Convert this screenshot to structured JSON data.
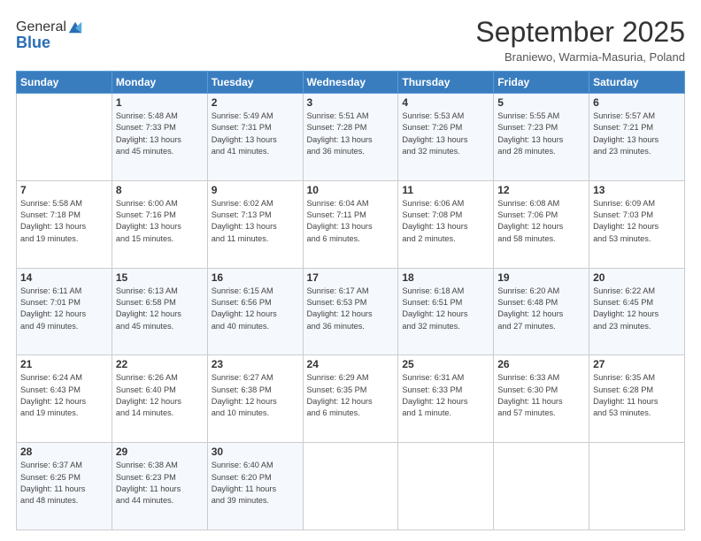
{
  "logo": {
    "line1": "General",
    "line2": "Blue"
  },
  "title": "September 2025",
  "location": "Braniewo, Warmia-Masuria, Poland",
  "weekdays": [
    "Sunday",
    "Monday",
    "Tuesday",
    "Wednesday",
    "Thursday",
    "Friday",
    "Saturday"
  ],
  "weeks": [
    [
      {
        "day": "",
        "info": ""
      },
      {
        "day": "1",
        "info": "Sunrise: 5:48 AM\nSunset: 7:33 PM\nDaylight: 13 hours\nand 45 minutes."
      },
      {
        "day": "2",
        "info": "Sunrise: 5:49 AM\nSunset: 7:31 PM\nDaylight: 13 hours\nand 41 minutes."
      },
      {
        "day": "3",
        "info": "Sunrise: 5:51 AM\nSunset: 7:28 PM\nDaylight: 13 hours\nand 36 minutes."
      },
      {
        "day": "4",
        "info": "Sunrise: 5:53 AM\nSunset: 7:26 PM\nDaylight: 13 hours\nand 32 minutes."
      },
      {
        "day": "5",
        "info": "Sunrise: 5:55 AM\nSunset: 7:23 PM\nDaylight: 13 hours\nand 28 minutes."
      },
      {
        "day": "6",
        "info": "Sunrise: 5:57 AM\nSunset: 7:21 PM\nDaylight: 13 hours\nand 23 minutes."
      }
    ],
    [
      {
        "day": "7",
        "info": "Sunrise: 5:58 AM\nSunset: 7:18 PM\nDaylight: 13 hours\nand 19 minutes."
      },
      {
        "day": "8",
        "info": "Sunrise: 6:00 AM\nSunset: 7:16 PM\nDaylight: 13 hours\nand 15 minutes."
      },
      {
        "day": "9",
        "info": "Sunrise: 6:02 AM\nSunset: 7:13 PM\nDaylight: 13 hours\nand 11 minutes."
      },
      {
        "day": "10",
        "info": "Sunrise: 6:04 AM\nSunset: 7:11 PM\nDaylight: 13 hours\nand 6 minutes."
      },
      {
        "day": "11",
        "info": "Sunrise: 6:06 AM\nSunset: 7:08 PM\nDaylight: 13 hours\nand 2 minutes."
      },
      {
        "day": "12",
        "info": "Sunrise: 6:08 AM\nSunset: 7:06 PM\nDaylight: 12 hours\nand 58 minutes."
      },
      {
        "day": "13",
        "info": "Sunrise: 6:09 AM\nSunset: 7:03 PM\nDaylight: 12 hours\nand 53 minutes."
      }
    ],
    [
      {
        "day": "14",
        "info": "Sunrise: 6:11 AM\nSunset: 7:01 PM\nDaylight: 12 hours\nand 49 minutes."
      },
      {
        "day": "15",
        "info": "Sunrise: 6:13 AM\nSunset: 6:58 PM\nDaylight: 12 hours\nand 45 minutes."
      },
      {
        "day": "16",
        "info": "Sunrise: 6:15 AM\nSunset: 6:56 PM\nDaylight: 12 hours\nand 40 minutes."
      },
      {
        "day": "17",
        "info": "Sunrise: 6:17 AM\nSunset: 6:53 PM\nDaylight: 12 hours\nand 36 minutes."
      },
      {
        "day": "18",
        "info": "Sunrise: 6:18 AM\nSunset: 6:51 PM\nDaylight: 12 hours\nand 32 minutes."
      },
      {
        "day": "19",
        "info": "Sunrise: 6:20 AM\nSunset: 6:48 PM\nDaylight: 12 hours\nand 27 minutes."
      },
      {
        "day": "20",
        "info": "Sunrise: 6:22 AM\nSunset: 6:45 PM\nDaylight: 12 hours\nand 23 minutes."
      }
    ],
    [
      {
        "day": "21",
        "info": "Sunrise: 6:24 AM\nSunset: 6:43 PM\nDaylight: 12 hours\nand 19 minutes."
      },
      {
        "day": "22",
        "info": "Sunrise: 6:26 AM\nSunset: 6:40 PM\nDaylight: 12 hours\nand 14 minutes."
      },
      {
        "day": "23",
        "info": "Sunrise: 6:27 AM\nSunset: 6:38 PM\nDaylight: 12 hours\nand 10 minutes."
      },
      {
        "day": "24",
        "info": "Sunrise: 6:29 AM\nSunset: 6:35 PM\nDaylight: 12 hours\nand 6 minutes."
      },
      {
        "day": "25",
        "info": "Sunrise: 6:31 AM\nSunset: 6:33 PM\nDaylight: 12 hours\nand 1 minute."
      },
      {
        "day": "26",
        "info": "Sunrise: 6:33 AM\nSunset: 6:30 PM\nDaylight: 11 hours\nand 57 minutes."
      },
      {
        "day": "27",
        "info": "Sunrise: 6:35 AM\nSunset: 6:28 PM\nDaylight: 11 hours\nand 53 minutes."
      }
    ],
    [
      {
        "day": "28",
        "info": "Sunrise: 6:37 AM\nSunset: 6:25 PM\nDaylight: 11 hours\nand 48 minutes."
      },
      {
        "day": "29",
        "info": "Sunrise: 6:38 AM\nSunset: 6:23 PM\nDaylight: 11 hours\nand 44 minutes."
      },
      {
        "day": "30",
        "info": "Sunrise: 6:40 AM\nSunset: 6:20 PM\nDaylight: 11 hours\nand 39 minutes."
      },
      {
        "day": "",
        "info": ""
      },
      {
        "day": "",
        "info": ""
      },
      {
        "day": "",
        "info": ""
      },
      {
        "day": "",
        "info": ""
      }
    ]
  ]
}
